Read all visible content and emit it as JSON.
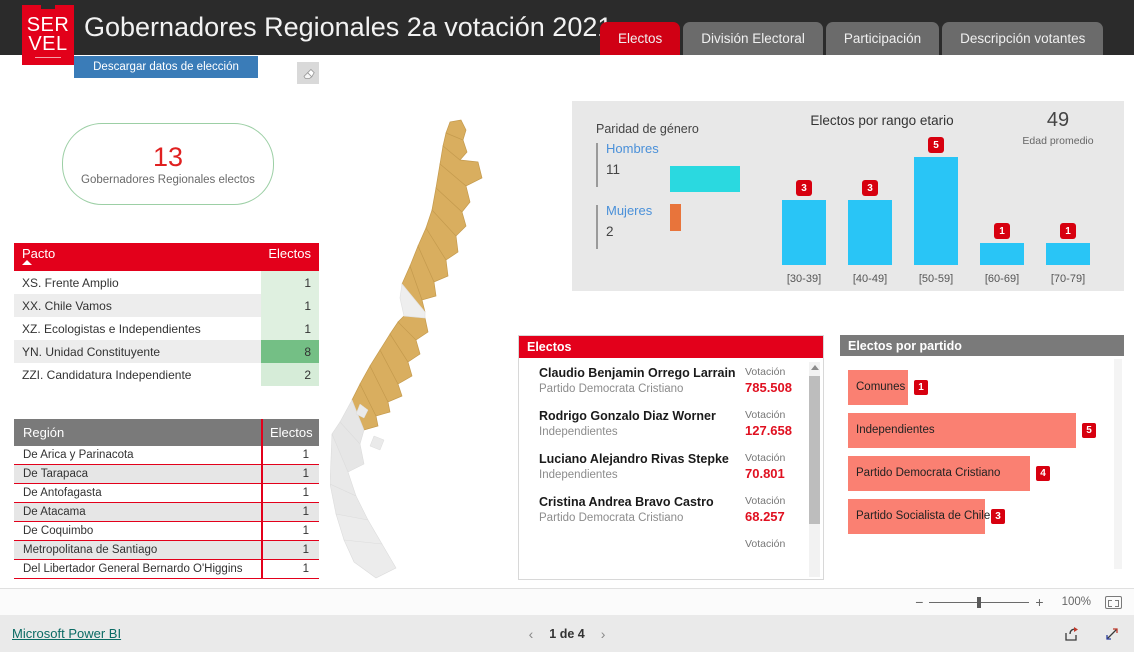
{
  "header": {
    "logo_line1": "SER",
    "logo_line2": "VEL",
    "title": "Gobernadores Regionales 2a votación 2021",
    "tabs": [
      {
        "label": "Electos",
        "active": true
      },
      {
        "label": "División Electoral",
        "active": false
      },
      {
        "label": "Participación",
        "active": false
      },
      {
        "label": "Descripción votantes",
        "active": false
      }
    ]
  },
  "toolbar": {
    "download_label": "Descargar datos de elección",
    "eraser_icon": "eraser-icon"
  },
  "kpi": {
    "value": "13",
    "label": "Gobernadores Regionales electos"
  },
  "pacto_table": {
    "col_name": "Pacto",
    "col_value": "Electos",
    "rows": [
      {
        "name": "XS. Frente Amplio",
        "value": "1",
        "bg": "#dff0e0"
      },
      {
        "name": "XX. Chile Vamos",
        "value": "1",
        "bg": "#dff0e0"
      },
      {
        "name": "XZ. Ecologistas e Independientes",
        "value": "1",
        "bg": "#dff0e0"
      },
      {
        "name": "YN. Unidad Constituyente",
        "value": "8",
        "bg": "#74bf85"
      },
      {
        "name": "ZZI. Candidatura Independiente",
        "value": "2",
        "bg": "#d6ecd8"
      }
    ]
  },
  "region_table": {
    "col_name": "Región",
    "col_value": "Electos",
    "rows": [
      {
        "name": "De Arica y Parinacota",
        "value": "1"
      },
      {
        "name": "De Tarapaca",
        "value": "1"
      },
      {
        "name": "De Antofagasta",
        "value": "1"
      },
      {
        "name": "De Atacama",
        "value": "1"
      },
      {
        "name": "De Coquimbo",
        "value": "1"
      },
      {
        "name": "Metropolitana de Santiago",
        "value": "1"
      },
      {
        "name": "Del Libertador General Bernardo O'Higgins",
        "value": "1"
      }
    ]
  },
  "map": {
    "name": "chile-map",
    "highlight_color": "#d9ae5f",
    "inactive_color": "#e3e3e3"
  },
  "parity": {
    "title": "Paridad de género",
    "men_label": "Hombres",
    "men_value": "11",
    "men_color": "#2ad9e0",
    "women_label": "Mujeres",
    "women_value": "2",
    "women_color": "#e8743b"
  },
  "avg_age": {
    "value": "49",
    "label": "Edad promedio"
  },
  "chart_data": {
    "type": "bar",
    "title": "Electos por rango etario",
    "categories": [
      "[30-39]",
      "[40-49]",
      "[50-59]",
      "[60-69]",
      "[70-79]"
    ],
    "values": [
      3,
      3,
      5,
      1,
      1
    ],
    "xlabel": "",
    "ylabel": "",
    "ylim": [
      0,
      5
    ],
    "bar_color": "#29c5f6",
    "label_badge_color": "#d7000f",
    "grid": false,
    "legend": "none"
  },
  "electos_list": {
    "title": "Electos",
    "vot_label": "Votación",
    "items": [
      {
        "name": "Claudio Benjamin Orrego Larrain",
        "party": "Partido Democrata Cristiano",
        "votes": "785.508"
      },
      {
        "name": "Rodrigo Gonzalo Diaz Worner",
        "party": "Independientes",
        "votes": "127.658"
      },
      {
        "name": "Luciano Alejandro Rivas Stepke",
        "party": "Independientes",
        "votes": "70.801"
      },
      {
        "name": "Cristina Andrea Bravo Castro",
        "party": "Partido Democrata Cristiano",
        "votes": "68.257"
      }
    ]
  },
  "partido_chart": {
    "type": "bar",
    "title": "Electos por partido",
    "orientation": "horizontal",
    "categories": [
      "Comunes",
      "Independientes",
      "Partido Democrata Cristiano",
      "Partido Socialista de Chile"
    ],
    "values": [
      1,
      5,
      4,
      3
    ],
    "bar_color": "#fa8072",
    "badge_color": "#d7000f"
  },
  "zoombar": {
    "minus": "−",
    "plus": "+",
    "percent": "100%",
    "fit_icon": "fit-to-screen-icon"
  },
  "footer": {
    "link": "Microsoft Power BI",
    "prev_icon": "chevron-left-icon",
    "page_text": "1 de 4",
    "next_icon": "chevron-right-icon",
    "share_icon": "share-icon",
    "fullscreen_icon": "fullscreen-icon"
  }
}
